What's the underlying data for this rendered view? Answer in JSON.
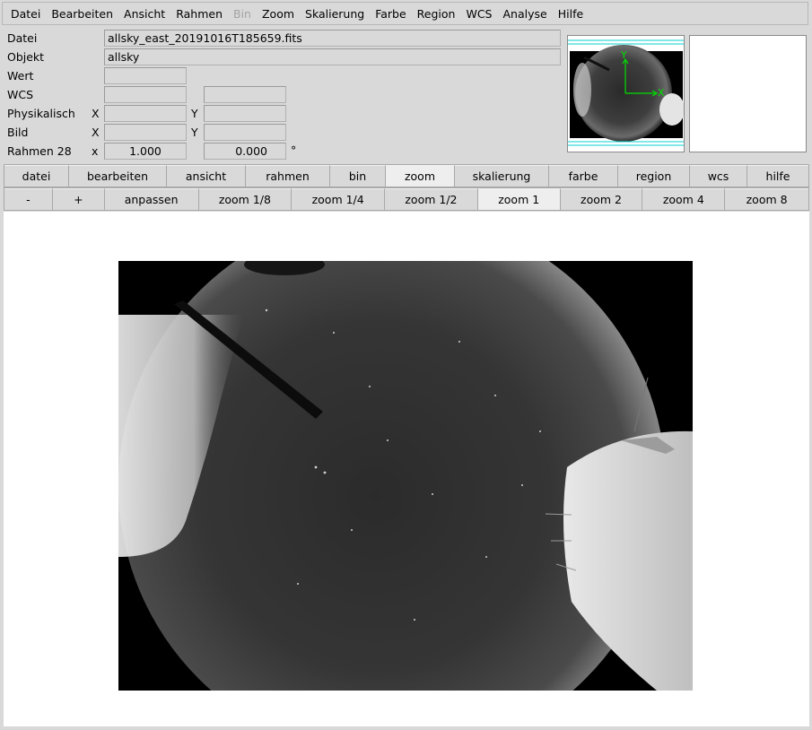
{
  "menubar": {
    "items": [
      {
        "label": "Datei",
        "enabled": true
      },
      {
        "label": "Bearbeiten",
        "enabled": true
      },
      {
        "label": "Ansicht",
        "enabled": true
      },
      {
        "label": "Rahmen",
        "enabled": true
      },
      {
        "label": "Bin",
        "enabled": false
      },
      {
        "label": "Zoom",
        "enabled": true
      },
      {
        "label": "Skalierung",
        "enabled": true
      },
      {
        "label": "Farbe",
        "enabled": true
      },
      {
        "label": "Region",
        "enabled": true
      },
      {
        "label": "WCS",
        "enabled": true
      },
      {
        "label": "Analyse",
        "enabled": true
      },
      {
        "label": "Hilfe",
        "enabled": true
      }
    ]
  },
  "info": {
    "file_label": "Datei",
    "file_value": "allsky_east_20191016T185659.fits",
    "object_label": "Objekt",
    "object_value": "allsky",
    "value_label": "Wert",
    "value_value": "",
    "wcs_label": "WCS",
    "wcs_value1": "",
    "wcs_value2": "",
    "physical_label": "Physikalisch",
    "physical_x_label": "X",
    "physical_x_value": "",
    "physical_y_label": "Y",
    "physical_y_value": "",
    "image_label": "Bild",
    "image_x_label": "X",
    "image_x_value": "",
    "image_y_label": "Y",
    "image_y_value": "",
    "frame_label": "Rahmen 28",
    "frame_x_label": "x",
    "zoom_value": "1.000",
    "angle_value": "0.000",
    "degree_symbol": "°"
  },
  "panner": {
    "x_label": "X",
    "y_label": "Y",
    "compass_color": "#00e000",
    "border_color": "#00d0d0"
  },
  "buttonbar": {
    "major": [
      {
        "label": "datei",
        "active": false
      },
      {
        "label": "bearbeiten",
        "active": false
      },
      {
        "label": "ansicht",
        "active": false
      },
      {
        "label": "rahmen",
        "active": false
      },
      {
        "label": "bin",
        "active": false
      },
      {
        "label": "zoom",
        "active": true
      },
      {
        "label": "skalierung",
        "active": false
      },
      {
        "label": "farbe",
        "active": false
      },
      {
        "label": "region",
        "active": false
      },
      {
        "label": "wcs",
        "active": false
      },
      {
        "label": "hilfe",
        "active": false
      }
    ],
    "zoom": [
      {
        "label": "-",
        "active": false
      },
      {
        "label": "+",
        "active": false
      },
      {
        "label": "anpassen",
        "active": false
      },
      {
        "label": "zoom 1/8",
        "active": false
      },
      {
        "label": "zoom 1/4",
        "active": false
      },
      {
        "label": "zoom 1/2",
        "active": false
      },
      {
        "label": "zoom 1",
        "active": true
      },
      {
        "label": "zoom 2",
        "active": false
      },
      {
        "label": "zoom 4",
        "active": false
      },
      {
        "label": "zoom 8",
        "active": false
      }
    ]
  }
}
